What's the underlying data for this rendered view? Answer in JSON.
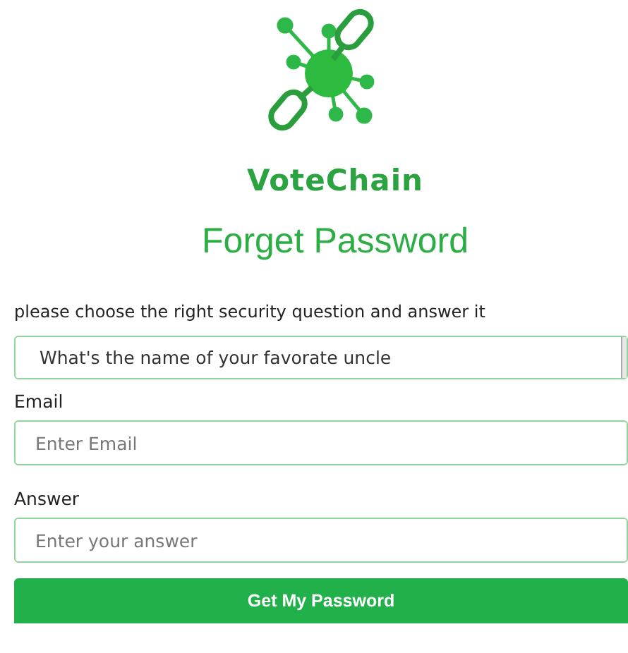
{
  "brand": {
    "name": "VoteChain"
  },
  "heading": "Forget Password",
  "instruction": "please choose the right security question and answer it",
  "question": {
    "value": "What's the name of your favorate uncle"
  },
  "fields": [
    {
      "label": "Email",
      "placeholder": "Enter Email"
    },
    {
      "label": "Answer",
      "placeholder": "Enter your answer"
    }
  ],
  "submit": "Get My Password"
}
